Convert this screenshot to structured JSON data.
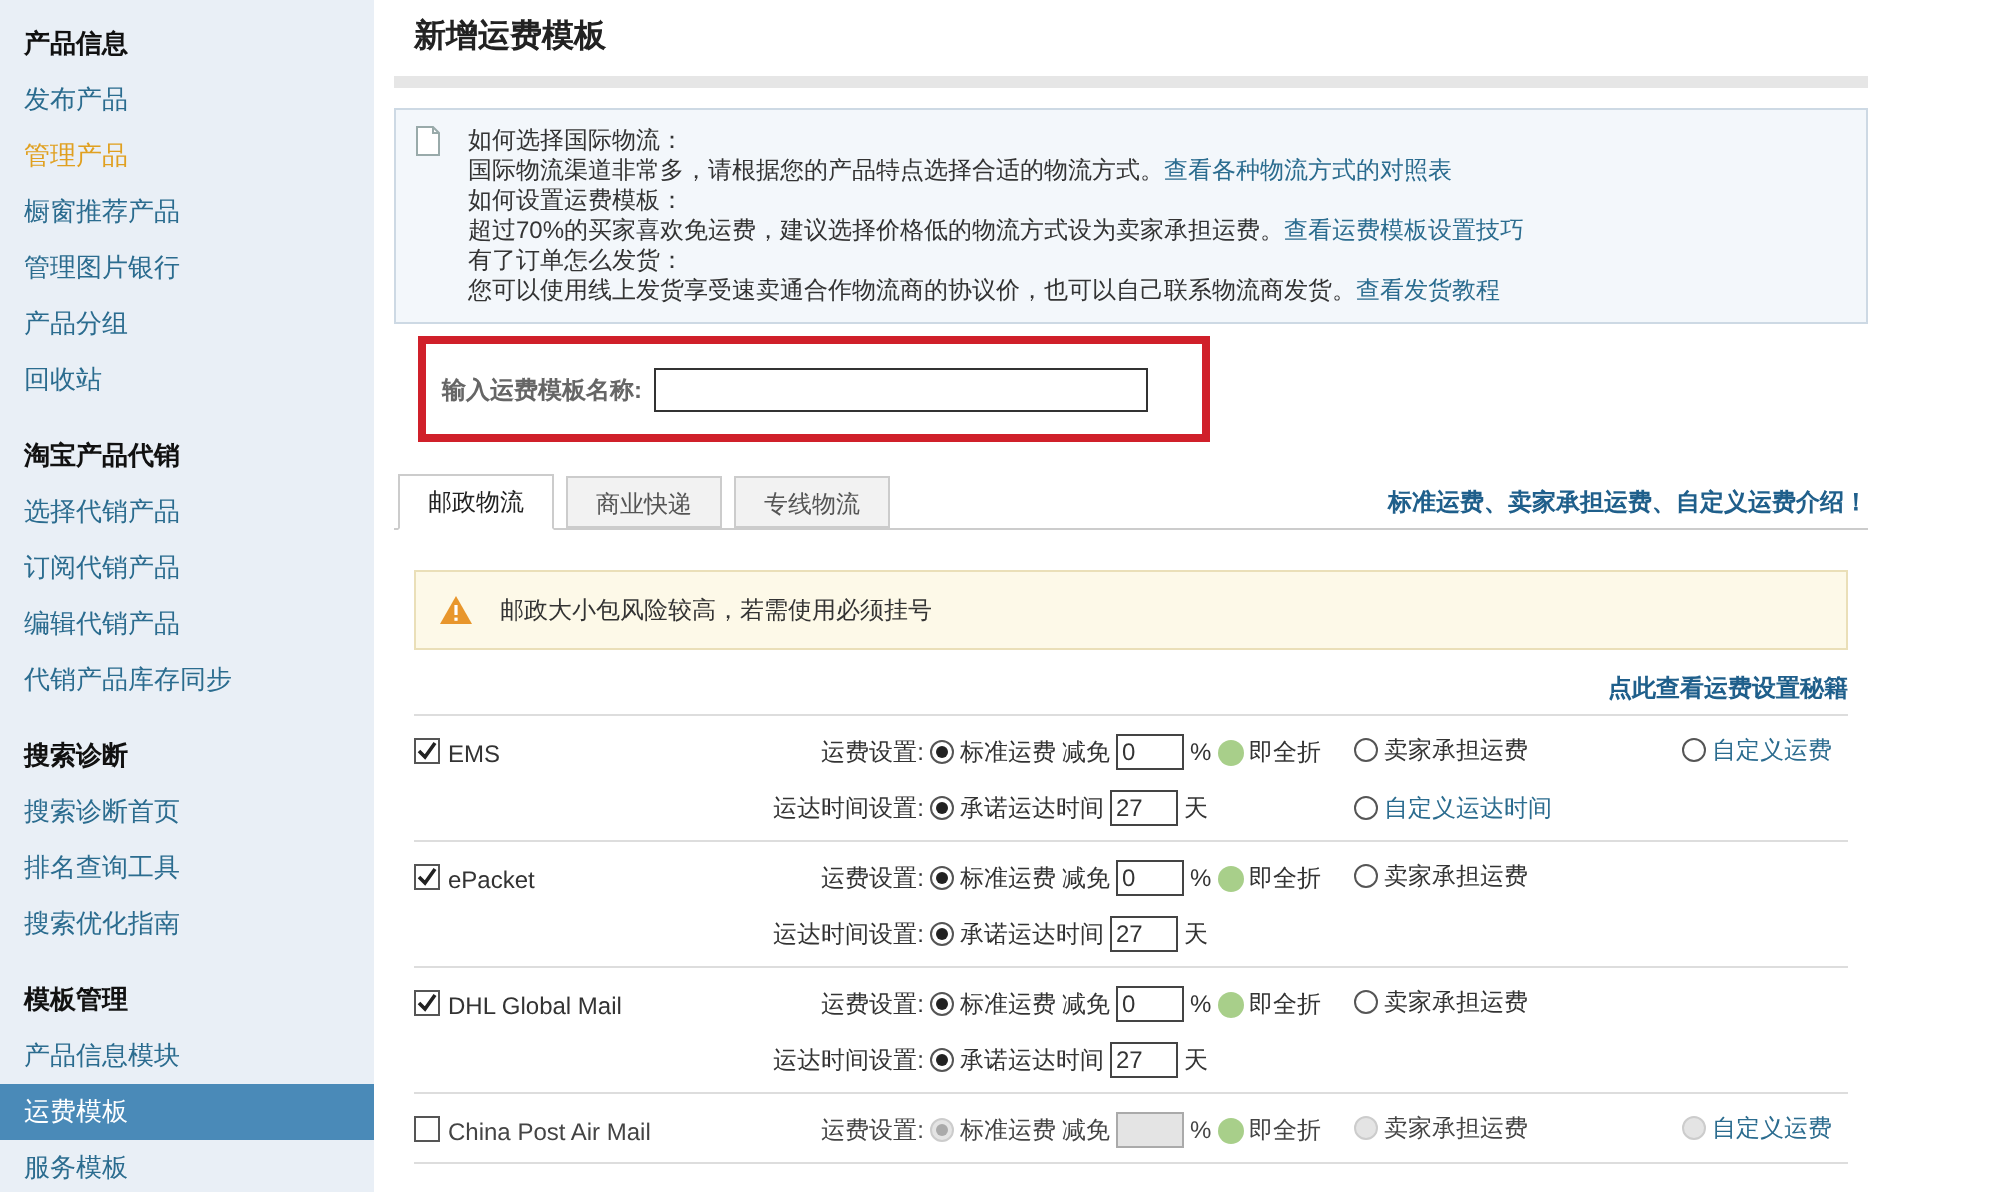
{
  "sidebar": {
    "sections": [
      {
        "title": "产品信息",
        "items": [
          {
            "label": "发布产品",
            "selected": false,
            "highlighted": false
          },
          {
            "label": "管理产品",
            "selected": false,
            "highlighted": true
          },
          {
            "label": "橱窗推荐产品",
            "selected": false,
            "highlighted": false
          },
          {
            "label": "管理图片银行",
            "selected": false,
            "highlighted": false
          },
          {
            "label": "产品分组",
            "selected": false,
            "highlighted": false
          },
          {
            "label": "回收站",
            "selected": false,
            "highlighted": false
          }
        ]
      },
      {
        "title": "淘宝产品代销",
        "items": [
          {
            "label": "选择代销产品",
            "selected": false,
            "highlighted": false
          },
          {
            "label": "订阅代销产品",
            "selected": false,
            "highlighted": false
          },
          {
            "label": "编辑代销产品",
            "selected": false,
            "highlighted": false
          },
          {
            "label": "代销产品库存同步",
            "selected": false,
            "highlighted": false
          }
        ]
      },
      {
        "title": "搜索诊断",
        "items": [
          {
            "label": "搜索诊断首页",
            "selected": false,
            "highlighted": false
          },
          {
            "label": "排名查询工具",
            "selected": false,
            "highlighted": false
          },
          {
            "label": "搜索优化指南",
            "selected": false,
            "highlighted": false
          }
        ]
      },
      {
        "title": "模板管理",
        "items": [
          {
            "label": "产品信息模块",
            "selected": false,
            "highlighted": false
          },
          {
            "label": "运费模板",
            "selected": true,
            "highlighted": false
          },
          {
            "label": "服务模板",
            "selected": false,
            "highlighted": false
          }
        ]
      }
    ]
  },
  "page_title": "新增运费模板",
  "info": [
    {
      "heading": "如何选择国际物流：",
      "text": "国际物流渠道非常多，请根据您的产品特点选择合适的物流方式。",
      "link": "查看各种物流方式的对照表"
    },
    {
      "heading": "如何设置运费模板：",
      "text": "超过70%的买家喜欢免运费，建议选择价格低的物流方式设为卖家承担运费。",
      "link": "查看运费模板设置技巧"
    },
    {
      "heading": "有了订单怎么发货：",
      "text": "您可以使用线上发货享受速卖通合作物流商的协议价，也可以自己联系物流商发货。",
      "link": "查看发货教程"
    }
  ],
  "name_field": {
    "label": "输入运费模板名称:"
  },
  "tabs": [
    {
      "label": "邮政物流",
      "selected": true
    },
    {
      "label": "商业快递",
      "selected": false
    },
    {
      "label": "专线物流",
      "selected": false
    }
  ],
  "tabs_link": "标准运费、卖家承担运费、自定义运费介绍！",
  "warning": "邮政大小包风险较高，若需使用必须挂号",
  "tips_link": "点此查看运费设置秘籍",
  "rows": [
    {
      "name": "EMS",
      "checked": true,
      "disabled": false,
      "fee_label": "运费设置:",
      "standard": {
        "label": "标准运费",
        "selected": true
      },
      "discount_label": "减免",
      "discount": "0",
      "percent": "%",
      "full_label": "即全折",
      "seller": {
        "label": "卖家承担运费",
        "selected": false
      },
      "custom": {
        "label": "自定义运费",
        "selected": false
      },
      "time": {
        "label": "运达时间设置:",
        "promise": {
          "label": "承诺运达时间",
          "selected": true
        },
        "days": "27",
        "unit": "天",
        "custom": {
          "label": "自定义运达时间",
          "selected": false
        }
      }
    },
    {
      "name": "ePacket",
      "checked": true,
      "disabled": false,
      "fee_label": "运费设置:",
      "standard": {
        "label": "标准运费",
        "selected": true
      },
      "discount_label": "减免",
      "discount": "0",
      "percent": "%",
      "full_label": "即全折",
      "seller": {
        "label": "卖家承担运费",
        "selected": false
      },
      "time": {
        "label": "运达时间设置:",
        "promise": {
          "label": "承诺运达时间",
          "selected": true
        },
        "days": "27",
        "unit": "天"
      }
    },
    {
      "name": "DHL Global Mail",
      "checked": true,
      "disabled": false,
      "fee_label": "运费设置:",
      "standard": {
        "label": "标准运费",
        "selected": true
      },
      "discount_label": "减免",
      "discount": "0",
      "percent": "%",
      "full_label": "即全折",
      "seller": {
        "label": "卖家承担运费",
        "selected": false
      },
      "time": {
        "label": "运达时间设置:",
        "promise": {
          "label": "承诺运达时间",
          "selected": true
        },
        "days": "27",
        "unit": "天"
      }
    },
    {
      "name": "China Post Air Mail",
      "checked": false,
      "disabled": true,
      "fee_label": "运费设置:",
      "standard": {
        "label": "标准运费",
        "selected": true
      },
      "discount_label": "减免",
      "discount": "",
      "percent": "%",
      "full_label": "即全折",
      "seller": {
        "label": "卖家承担运费",
        "selected": false
      },
      "custom": {
        "label": "自定义运费",
        "selected": false
      }
    }
  ]
}
